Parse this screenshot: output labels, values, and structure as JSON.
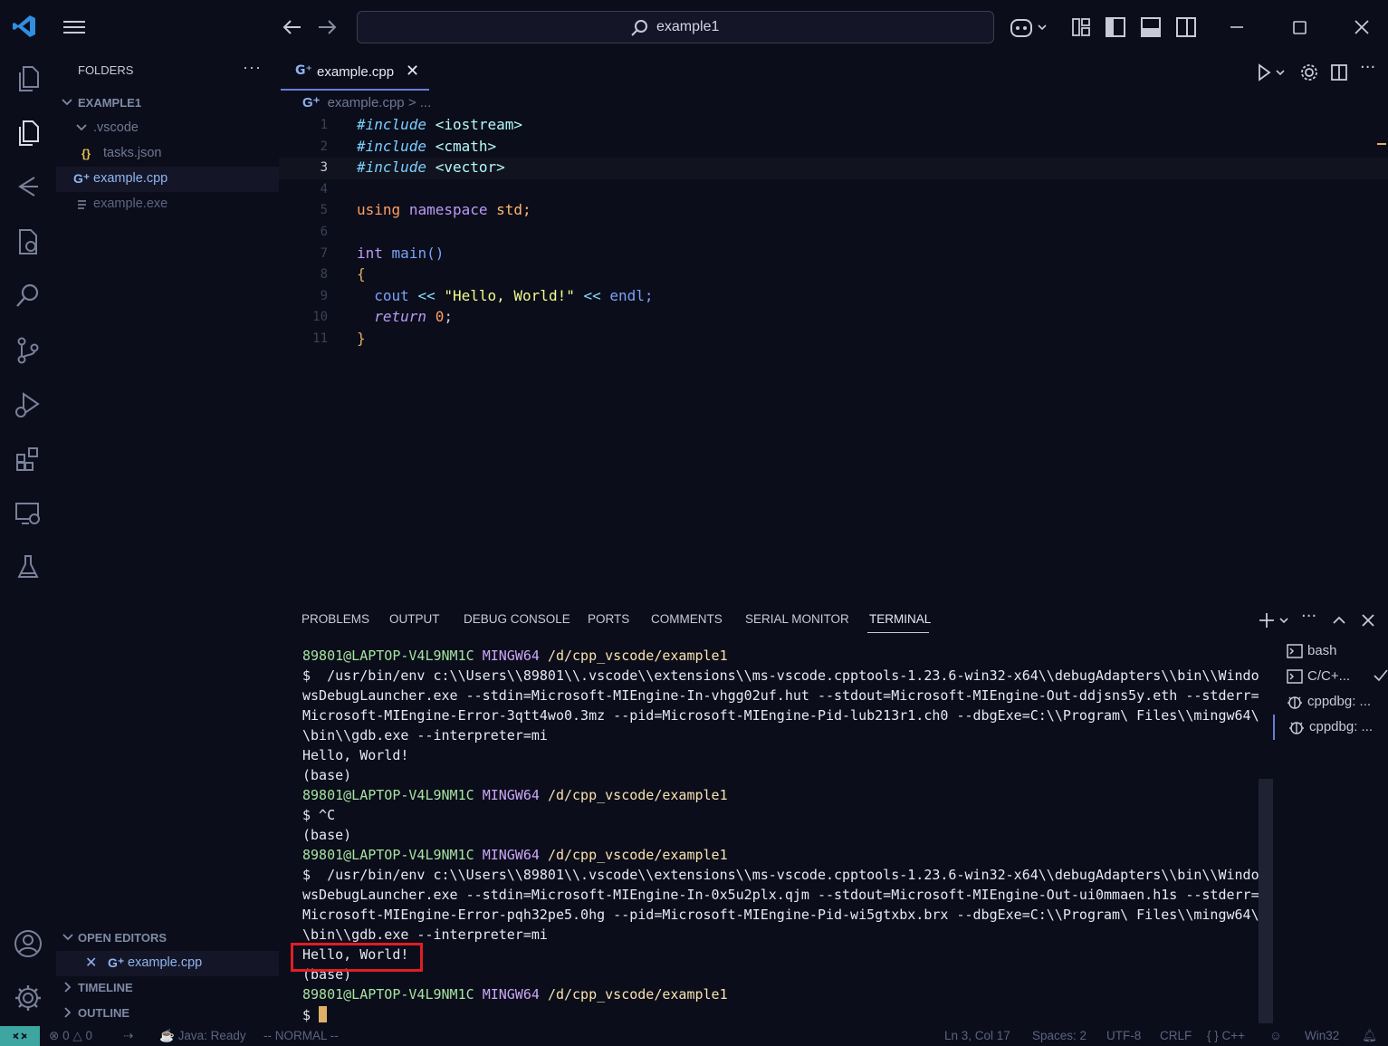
{
  "titlebar": {
    "search_text": "example1"
  },
  "sidebar": {
    "header": "FOLDERS",
    "more": "···",
    "root": "EXAMPLE1",
    "items": [
      {
        "label": ".vscode",
        "icon": "chevron-down-icon"
      },
      {
        "label": "tasks.json",
        "icon": "json-braces-icon"
      },
      {
        "label": "example.cpp",
        "icon": "cpp-file-icon"
      },
      {
        "label": "example.exe",
        "icon": "file-lines-icon"
      }
    ],
    "open_editors": {
      "title": "OPEN EDITORS",
      "file": "example.cpp"
    },
    "timeline": "TIMELINE",
    "outline": "OUTLINE"
  },
  "editor": {
    "tab_label": "example.cpp",
    "breadcrumb_file": "example.cpp",
    "breadcrumb_rest": "> ...",
    "lines": [
      {
        "n": "1"
      },
      {
        "n": "2"
      },
      {
        "n": "3"
      },
      {
        "n": "4"
      },
      {
        "n": "5"
      },
      {
        "n": "6"
      },
      {
        "n": "7"
      },
      {
        "n": "8"
      },
      {
        "n": "9"
      },
      {
        "n": "10"
      },
      {
        "n": "11"
      }
    ],
    "code": {
      "inc": "#include",
      "h1": "<iostream>",
      "h2": "<cmath>",
      "h3": "<vector>",
      "using": "using",
      "namespace": "namespace",
      "std": "std;",
      "int": "int",
      "main": "main()",
      "open": "{",
      "cout": "cout",
      "op": "<<",
      "str": "\"Hello, World!\"",
      "endl": "endl;",
      "ret": "return",
      "zero": "0",
      "semi": ";",
      "close": "}"
    }
  },
  "panel": {
    "tabs": [
      "PROBLEMS",
      "OUTPUT",
      "DEBUG CONSOLE",
      "PORTS",
      "COMMENTS",
      "SERIAL MONITOR",
      "TERMINAL"
    ],
    "terminal": {
      "user": "89801@LAPTOP-V4L9NM1C",
      "sys": "MINGW64",
      "path": "/d/cpp_vscode/example1",
      "cmd1a": "$  /usr/bin/env c:\\\\Users\\\\89801\\\\.vscode\\\\extensions\\\\ms-vscode.cpptools-1.23.6-win32-x64\\\\debugAdapters\\\\bin\\\\Windo",
      "cmd1b": "wsDebugLauncher.exe --stdin=Microsoft-MIEngine-In-vhgg02uf.hut --stdout=Microsoft-MIEngine-Out-ddjsns5y.eth --stderr=",
      "cmd1c": "Microsoft-MIEngine-Error-3qtt4wo0.3mz --pid=Microsoft-MIEngine-Pid-lub213r1.ch0 --dbgExe=C:\\\\Program\\ Files\\\\mingw64\\",
      "cmd1d": "\\bin\\\\gdb.exe --interpreter=mi",
      "hello": "Hello, World!",
      "base": "(base)",
      "ctrlc": "$ ^C",
      "cmd2a": "$  /usr/bin/env c:\\\\Users\\\\89801\\\\.vscode\\\\extensions\\\\ms-vscode.cpptools-1.23.6-win32-x64\\\\debugAdapters\\\\bin\\\\Windo",
      "cmd2b": "wsDebugLauncher.exe --stdin=Microsoft-MIEngine-In-0x5u2plx.qjm --stdout=Microsoft-MIEngine-Out-ui0mmaen.h1s --stderr=",
      "cmd2c": "Microsoft-MIEngine-Error-pqh32pe5.0hg --pid=Microsoft-MIEngine-Pid-wi5gtxbx.brx --dbgExe=C:\\\\Program\\ Files\\\\mingw64\\",
      "cmd2d": "\\bin\\\\gdb.exe --interpreter=mi",
      "prompt": "$"
    },
    "terminal_list": [
      "bash",
      "C/C+...",
      "cppdbg: ...",
      "cppdbg: ..."
    ]
  },
  "status": {
    "errors": "0",
    "warnings": "0",
    "java": "Java: Ready",
    "mode": "-- NORMAL --",
    "position": "Ln 3, Col 17",
    "spaces": "Spaces: 2",
    "encoding": "UTF-8",
    "eol": "CRLF",
    "lang": "{ } C++",
    "platform": "Win32"
  },
  "colors": {
    "background": "#0b0d1a",
    "accent": "#6b7cd4",
    "highlight_box": "#e11d24",
    "remote": "#3ea6a0"
  }
}
